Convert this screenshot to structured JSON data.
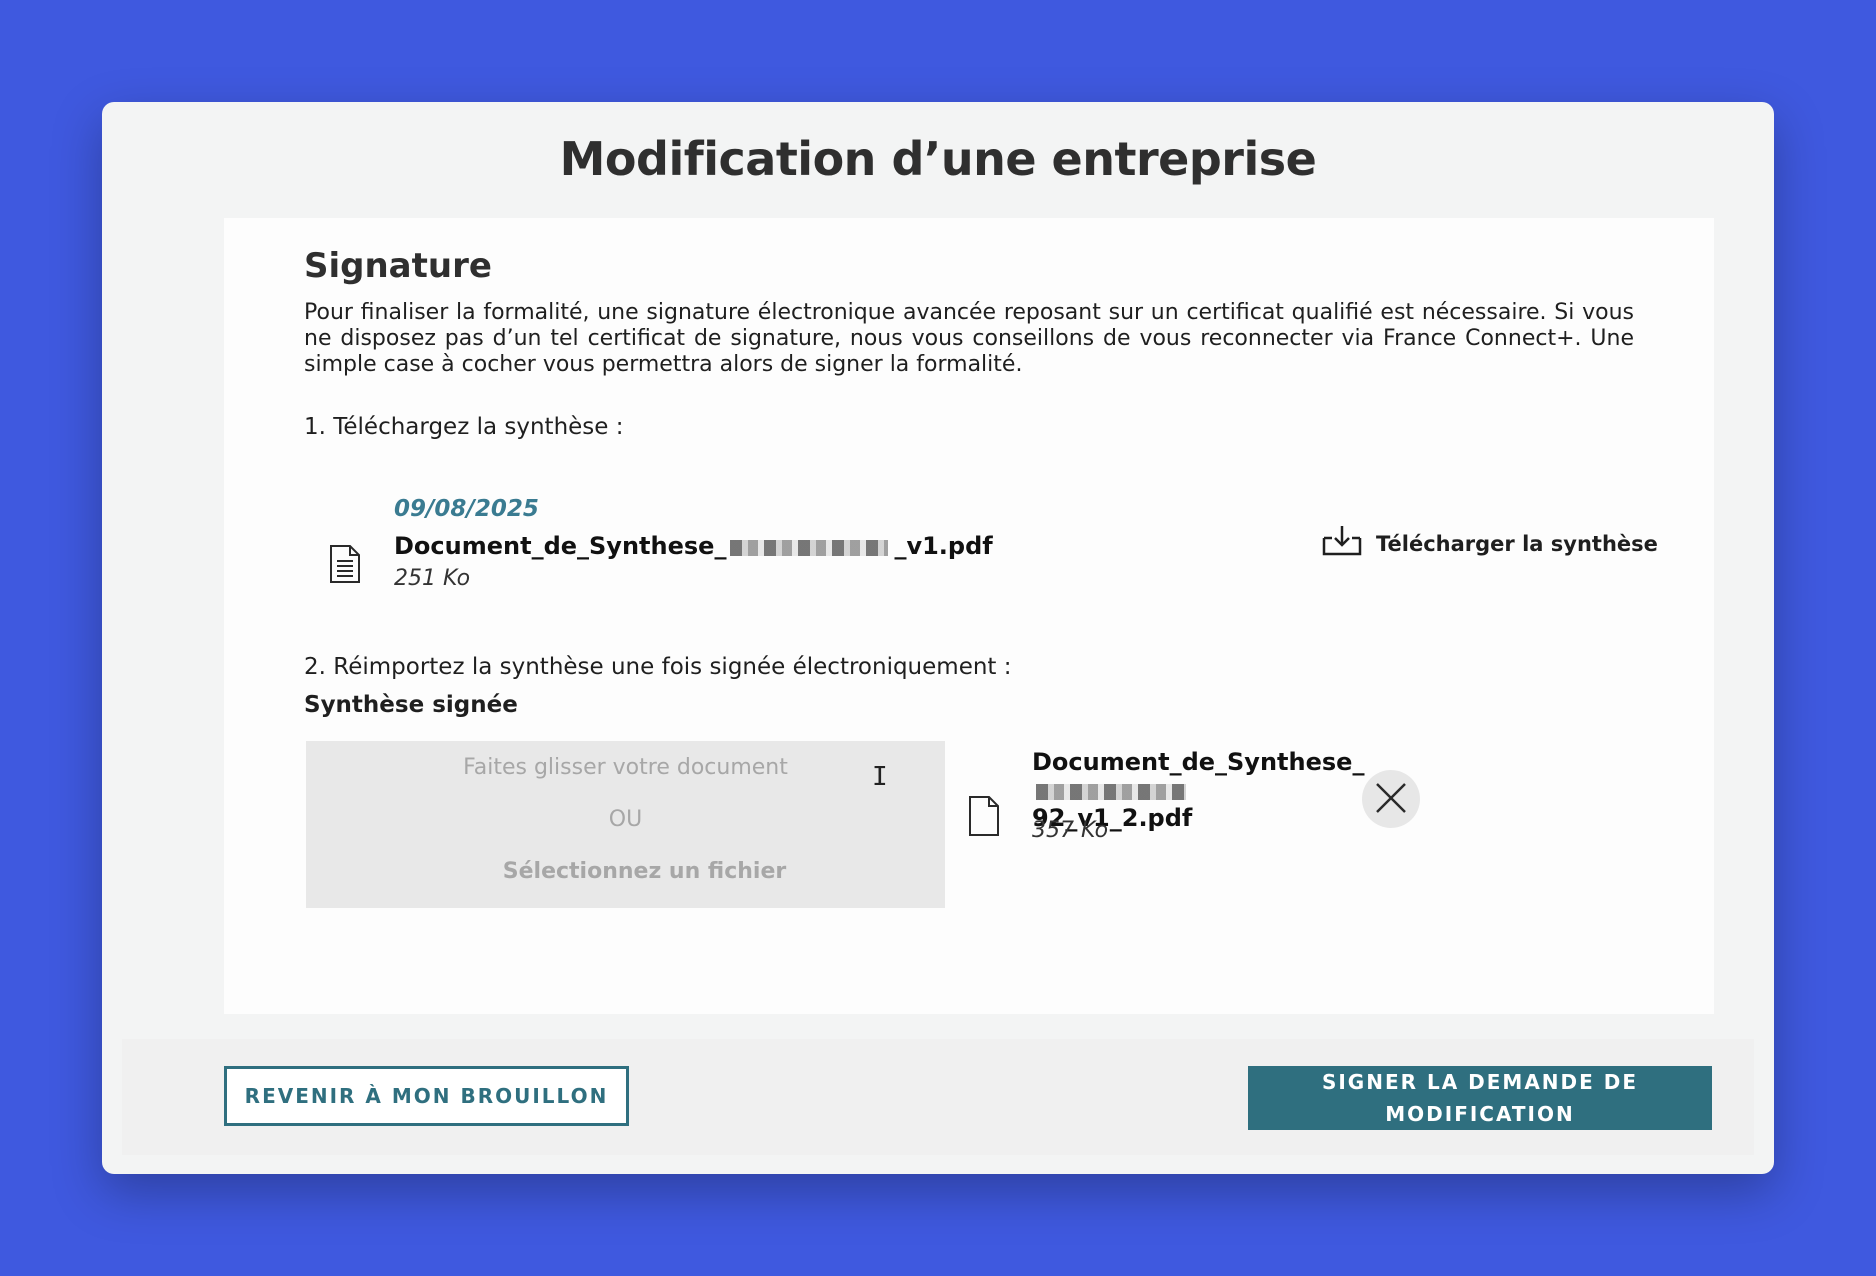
{
  "window": {
    "title": "Modification d’une entreprise"
  },
  "section": {
    "title": "Signature",
    "intro": "Pour finaliser la formalité, une signature électronique avancée reposant sur un certificat qualifié est nécessaire. Si vous ne disposez pas d’un tel certificat de signature, nous vous conseillons de vous reconnecter via France Connect+. Une simple case à cocher vous permettra alors de signer la formalité."
  },
  "step1": {
    "label": "1. Téléchargez la synthèse :",
    "file": {
      "date": "09/08/2025",
      "name_prefix": "Document_de_Synthese_",
      "name_suffix": "_v1.pdf",
      "size": "251 Ko"
    },
    "download_label": "Télécharger la synthèse"
  },
  "step2": {
    "label": "2. Réimportez la synthèse une fois signée électroniquement :",
    "subheading": "Synthèse signée",
    "dropzone": {
      "line1": "Faites glisser votre document",
      "line2": "OU",
      "line3": "Sélectionnez un fichier"
    },
    "uploaded": {
      "name_prefix": "Document_de_Synthese_",
      "name_suffix": "92_v1_2.pdf",
      "size": "357 Ko"
    }
  },
  "footer": {
    "back_label": "REVENIR À MON BROUILLON",
    "sign_label": "SIGNER LA DEMANDE DE MODIFICATION"
  },
  "colors": {
    "background": "#3f59df",
    "accent": "#2f6f7f",
    "date": "#3a7b91"
  },
  "icons": {
    "file_lines": "document-lines-icon",
    "download": "download-tray-icon",
    "file_blank": "document-icon",
    "close": "close-icon"
  }
}
